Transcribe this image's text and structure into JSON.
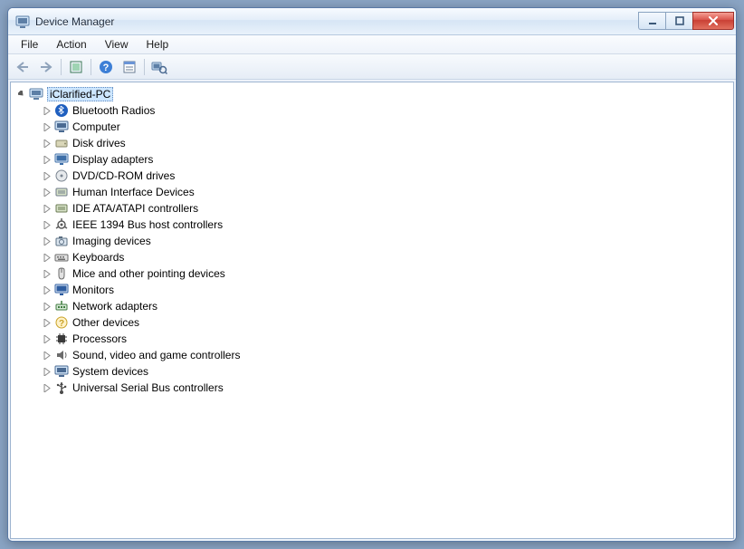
{
  "window": {
    "title": "Device Manager"
  },
  "menu": {
    "file": "File",
    "action": "Action",
    "view": "View",
    "help": "Help"
  },
  "toolbar": {
    "back": "Back",
    "forward": "Forward",
    "up": "Show hidden",
    "help": "Help",
    "properties": "Properties",
    "scan": "Scan for hardware changes"
  },
  "tree": {
    "root": "iClarified-PC",
    "items": [
      {
        "label": "Bluetooth Radios",
        "icon": "bluetooth-icon"
      },
      {
        "label": "Computer",
        "icon": "computer-icon"
      },
      {
        "label": "Disk drives",
        "icon": "disk-icon"
      },
      {
        "label": "Display adapters",
        "icon": "display-icon"
      },
      {
        "label": "DVD/CD-ROM drives",
        "icon": "cdrom-icon"
      },
      {
        "label": "Human Interface Devices",
        "icon": "hid-icon"
      },
      {
        "label": "IDE ATA/ATAPI controllers",
        "icon": "ide-icon"
      },
      {
        "label": "IEEE 1394 Bus host controllers",
        "icon": "firewire-icon"
      },
      {
        "label": "Imaging devices",
        "icon": "imaging-icon"
      },
      {
        "label": "Keyboards",
        "icon": "keyboard-icon"
      },
      {
        "label": "Mice and other pointing devices",
        "icon": "mouse-icon"
      },
      {
        "label": "Monitors",
        "icon": "monitor-icon"
      },
      {
        "label": "Network adapters",
        "icon": "network-icon"
      },
      {
        "label": "Other devices",
        "icon": "other-icon"
      },
      {
        "label": "Processors",
        "icon": "processor-icon"
      },
      {
        "label": "Sound, video and game controllers",
        "icon": "sound-icon"
      },
      {
        "label": "System devices",
        "icon": "system-icon"
      },
      {
        "label": "Universal Serial Bus controllers",
        "icon": "usb-icon"
      }
    ]
  },
  "icons": {
    "bluetooth-icon": "#1f5fbf",
    "computer-icon": "#4a6a92",
    "disk-icon": "#8a8a6a",
    "display-icon": "#3d6ea8",
    "cdrom-icon": "#7a8490",
    "hid-icon": "#6e7a88",
    "ide-icon": "#6a7a52",
    "firewire-icon": "#5a5a5a",
    "imaging-icon": "#5a6e82",
    "keyboard-icon": "#6b6b6b",
    "mouse-icon": "#6b6b6b",
    "monitor-icon": "#2d5ca0",
    "network-icon": "#3f7a3f",
    "other-icon": "#c9a227",
    "processor-icon": "#3a3a3a",
    "sound-icon": "#6b6b6b",
    "system-icon": "#4a6a92",
    "usb-icon": "#4a4a4a"
  }
}
